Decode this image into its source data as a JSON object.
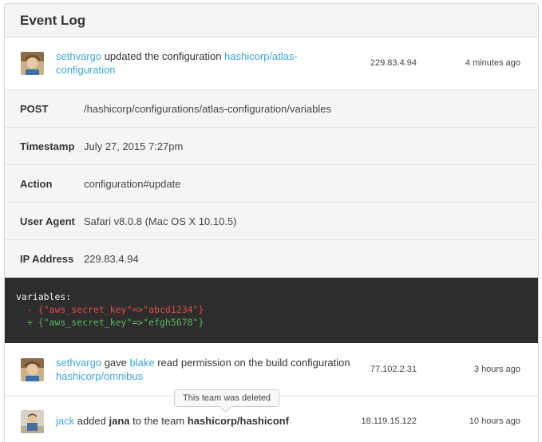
{
  "panel": {
    "title": "Event Log"
  },
  "events": [
    {
      "user": "sethvargo",
      "verb": " updated the configuration ",
      "target": "hashicorp/atlas-configuration",
      "ip": "229.83.4.94",
      "time": "4 minutes ago"
    },
    {
      "user": "sethvargo",
      "verb": " gave ",
      "user2": "blake",
      "verb2": " read permission on the build configuration ",
      "target": "hashicorp/omnibus",
      "ip": "77.102.2.31",
      "time": "3 hours ago"
    },
    {
      "user": "jack",
      "verb": " added ",
      "user2": "jana",
      "verb2": " to the team ",
      "target": "hashicorp/hashiconf",
      "ip": "18.119.15.122",
      "time": "10 hours ago",
      "tooltip": "This team was deleted"
    }
  ],
  "details": [
    {
      "label": "POST",
      "value": "/hashicorp/configurations/atlas-configuration/variables"
    },
    {
      "label": "Timestamp",
      "value": "July 27, 2015 7:27pm"
    },
    {
      "label": "Action",
      "value": "configuration#update"
    },
    {
      "label": "User Agent",
      "value": "Safari v8.0.8 (Mac OS X 10.10.5)"
    },
    {
      "label": "IP Address",
      "value": "229.83.4.94"
    }
  ],
  "code": {
    "header": "variables:",
    "removed": "  - {\"aws_secret_key\"=>\"abcd1234\"}",
    "added": "  + {\"aws_secret_key\"=>\"efgh5678\"}"
  }
}
